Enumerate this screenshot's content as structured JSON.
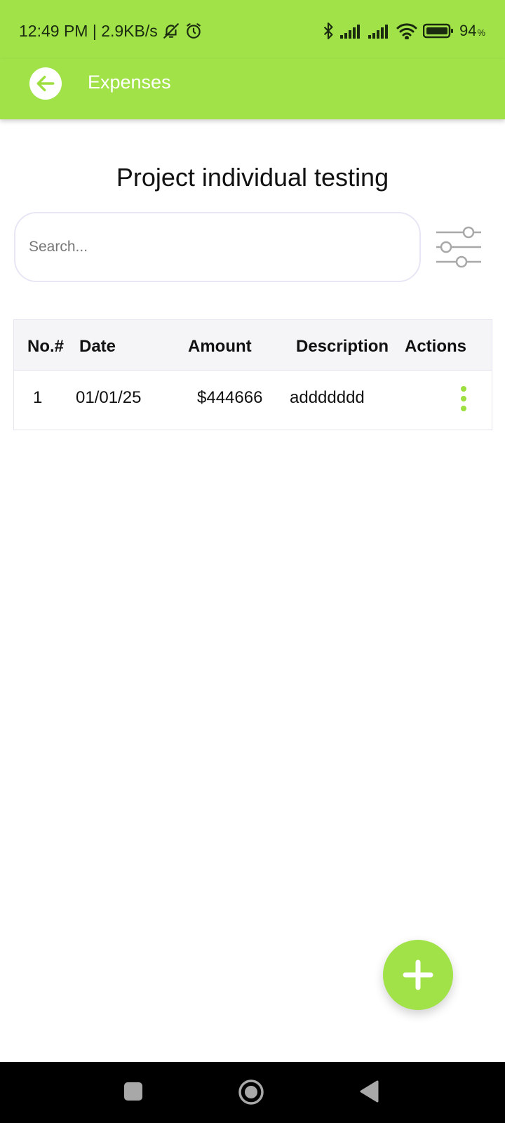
{
  "status_bar": {
    "time_info": "12:49 PM | 2.9KB/s",
    "battery": "94",
    "battery_unit": "%",
    "icons": [
      "bell-off-icon",
      "alarm-icon",
      "bluetooth-icon",
      "signal-icon",
      "signal-icon",
      "wifi-icon",
      "battery-icon"
    ]
  },
  "app_bar": {
    "title": "Expenses",
    "back_icon": "arrow-left-icon"
  },
  "page": {
    "title": "Project individual testing"
  },
  "search": {
    "placeholder": "Search...",
    "value": ""
  },
  "table": {
    "headers": [
      "No.#",
      "Date",
      "Amount",
      "Description",
      "Actions"
    ],
    "rows": [
      {
        "no": "1",
        "date": "01/01/25",
        "amount": "$444666",
        "description": "addddddd"
      }
    ]
  },
  "fab": {
    "icon": "plus-icon"
  },
  "colors": {
    "accent": "#a0e248",
    "action_dots": "#9ddf3e"
  }
}
